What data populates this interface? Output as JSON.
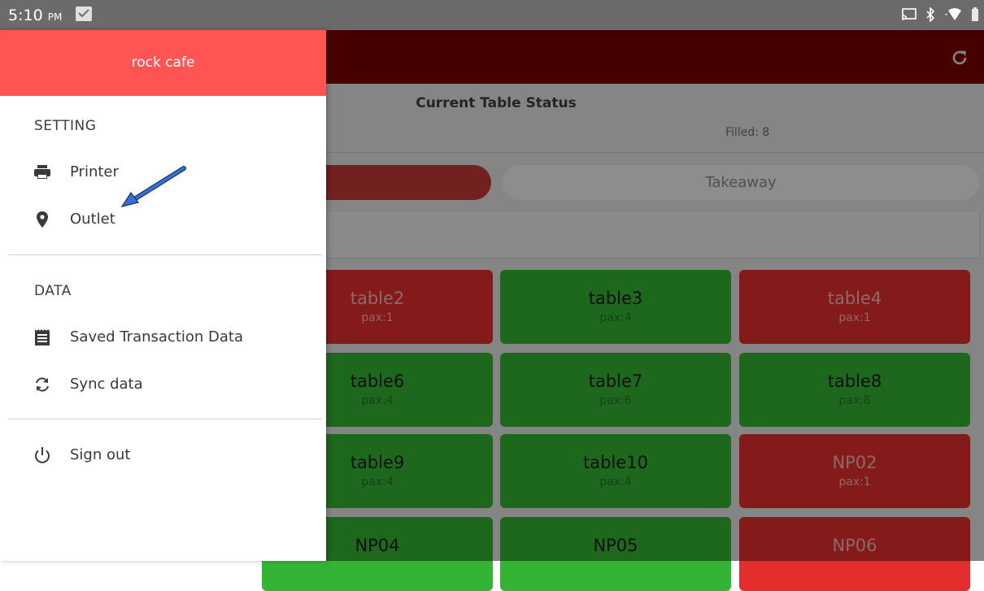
{
  "status_bar": {
    "time": "5:10",
    "ampm": "PM"
  },
  "header": {
    "refresh_icon": "refresh-icon"
  },
  "table_status": {
    "title": "Current Table Status",
    "filled": "Filled: 8"
  },
  "tabs": {
    "takeaway": "Takeaway"
  },
  "tables": [
    {
      "name": "table2",
      "pax": "pax:1",
      "status": "occupied"
    },
    {
      "name": "table3",
      "pax": "pax:4",
      "status": "available"
    },
    {
      "name": "table4",
      "pax": "pax:1",
      "status": "occupied"
    },
    {
      "name": "table6",
      "pax": "pax:4",
      "status": "available"
    },
    {
      "name": "table7",
      "pax": "pax:6",
      "status": "available"
    },
    {
      "name": "table8",
      "pax": "pax:8",
      "status": "available"
    },
    {
      "name": "table9",
      "pax": "pax:4",
      "status": "available"
    },
    {
      "name": "table10",
      "pax": "pax:4",
      "status": "available"
    },
    {
      "name": "NP02",
      "pax": "pax:1",
      "status": "occupied"
    },
    {
      "name": "NP04",
      "pax": "",
      "status": "available"
    },
    {
      "name": "NP05",
      "pax": "",
      "status": "available"
    },
    {
      "name": "NP06",
      "pax": "",
      "status": "occupied"
    }
  ],
  "drawer": {
    "header": "rock cafe",
    "setting_title": "SETTING",
    "printer": "Printer",
    "outlet": "Outlet",
    "data_title": "DATA",
    "saved_transaction": "Saved Transaction Data",
    "sync": "Sync data",
    "signout": "Sign out"
  },
  "colors": {
    "app_bar": "#7b0000",
    "drawer_header": "#ff5454",
    "available": "#34b434",
    "occupied": "#e52d2d",
    "annotation_arrow": "#3a6fd1"
  }
}
